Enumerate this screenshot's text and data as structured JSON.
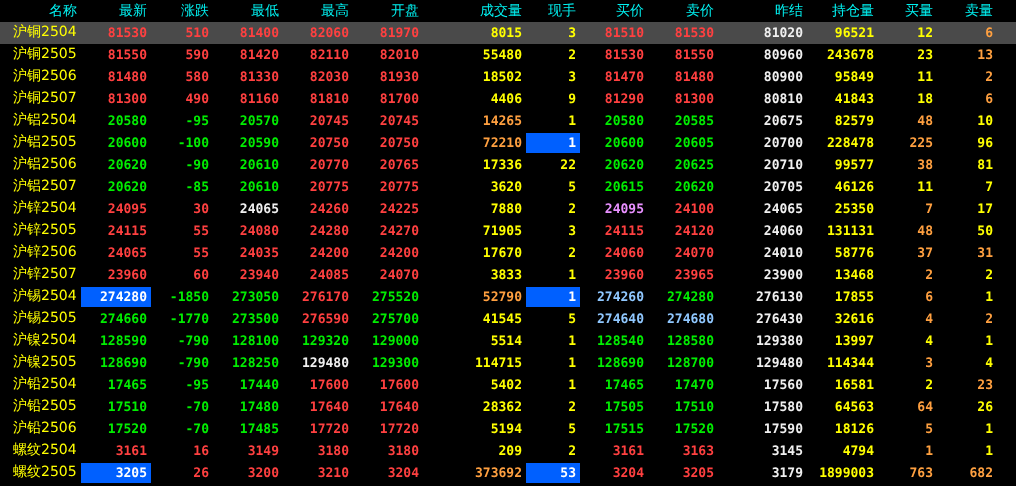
{
  "columns": [
    "名称",
    "最新",
    "涨跌",
    "最低",
    "最高",
    "开盘",
    "成交量",
    "现手",
    "买价",
    "卖价",
    "昨结",
    "持仓量",
    "买量",
    "卖量"
  ],
  "rows": [
    {
      "selected": true,
      "cells": [
        {
          "text": "沪铜2504",
          "color": "#ffff00",
          "highlighted": false
        },
        {
          "text": "81530",
          "color": "#ff4040",
          "highlighted": false
        },
        {
          "text": "510",
          "color": "#ff4040",
          "highlighted": false
        },
        {
          "text": "81400",
          "color": "#ff4040",
          "highlighted": false
        },
        {
          "text": "82060",
          "color": "#ff4040",
          "highlighted": false
        },
        {
          "text": "81970",
          "color": "#ff4040",
          "highlighted": false
        },
        {
          "text": "8015",
          "color": "#ffff00",
          "highlighted": false
        },
        {
          "text": "3",
          "color": "#ffff00",
          "highlighted": false
        },
        {
          "text": "81510",
          "color": "#ff4040",
          "highlighted": false
        },
        {
          "text": "81530",
          "color": "#ff4040",
          "highlighted": false
        },
        {
          "text": "81020",
          "color": "#f0f0f0",
          "highlighted": false
        },
        {
          "text": "96521",
          "color": "#ffff00",
          "highlighted": false
        },
        {
          "text": "12",
          "color": "#ffff00",
          "highlighted": false
        },
        {
          "text": "6",
          "color": "#ffa040",
          "highlighted": false
        }
      ]
    },
    {
      "selected": false,
      "cells": [
        {
          "text": "沪铜2505",
          "color": "#ffff00",
          "highlighted": false
        },
        {
          "text": "81550",
          "color": "#ff4040",
          "highlighted": false
        },
        {
          "text": "590",
          "color": "#ff4040",
          "highlighted": false
        },
        {
          "text": "81420",
          "color": "#ff4040",
          "highlighted": false
        },
        {
          "text": "82110",
          "color": "#ff4040",
          "highlighted": false
        },
        {
          "text": "82010",
          "color": "#ff4040",
          "highlighted": false
        },
        {
          "text": "55480",
          "color": "#ffff00",
          "highlighted": false
        },
        {
          "text": "2",
          "color": "#ffff00",
          "highlighted": false
        },
        {
          "text": "81530",
          "color": "#ff4040",
          "highlighted": false
        },
        {
          "text": "81550",
          "color": "#ff4040",
          "highlighted": false
        },
        {
          "text": "80960",
          "color": "#f0f0f0",
          "highlighted": false
        },
        {
          "text": "243678",
          "color": "#ffff00",
          "highlighted": false
        },
        {
          "text": "23",
          "color": "#ffff00",
          "highlighted": false
        },
        {
          "text": "13",
          "color": "#ffa040",
          "highlighted": false
        }
      ]
    },
    {
      "selected": false,
      "cells": [
        {
          "text": "沪铜2506",
          "color": "#ffff00",
          "highlighted": false
        },
        {
          "text": "81480",
          "color": "#ff4040",
          "highlighted": false
        },
        {
          "text": "580",
          "color": "#ff4040",
          "highlighted": false
        },
        {
          "text": "81330",
          "color": "#ff4040",
          "highlighted": false
        },
        {
          "text": "82030",
          "color": "#ff4040",
          "highlighted": false
        },
        {
          "text": "81930",
          "color": "#ff4040",
          "highlighted": false
        },
        {
          "text": "18502",
          "color": "#ffff00",
          "highlighted": false
        },
        {
          "text": "3",
          "color": "#ffff00",
          "highlighted": false
        },
        {
          "text": "81470",
          "color": "#ff4040",
          "highlighted": false
        },
        {
          "text": "81480",
          "color": "#ff4040",
          "highlighted": false
        },
        {
          "text": "80900",
          "color": "#f0f0f0",
          "highlighted": false
        },
        {
          "text": "95849",
          "color": "#ffff00",
          "highlighted": false
        },
        {
          "text": "11",
          "color": "#ffff00",
          "highlighted": false
        },
        {
          "text": "2",
          "color": "#ffa040",
          "highlighted": false
        }
      ]
    },
    {
      "selected": false,
      "cells": [
        {
          "text": "沪铜2507",
          "color": "#ffff00",
          "highlighted": false
        },
        {
          "text": "81300",
          "color": "#ff4040",
          "highlighted": false
        },
        {
          "text": "490",
          "color": "#ff4040",
          "highlighted": false
        },
        {
          "text": "81160",
          "color": "#ff4040",
          "highlighted": false
        },
        {
          "text": "81810",
          "color": "#ff4040",
          "highlighted": false
        },
        {
          "text": "81700",
          "color": "#ff4040",
          "highlighted": false
        },
        {
          "text": "4406",
          "color": "#ffff00",
          "highlighted": false
        },
        {
          "text": "9",
          "color": "#ffff00",
          "highlighted": false
        },
        {
          "text": "81290",
          "color": "#ff4040",
          "highlighted": false
        },
        {
          "text": "81300",
          "color": "#ff4040",
          "highlighted": false
        },
        {
          "text": "80810",
          "color": "#f0f0f0",
          "highlighted": false
        },
        {
          "text": "41843",
          "color": "#ffff00",
          "highlighted": false
        },
        {
          "text": "18",
          "color": "#ffff00",
          "highlighted": false
        },
        {
          "text": "6",
          "color": "#ffa040",
          "highlighted": false
        }
      ]
    },
    {
      "selected": false,
      "cells": [
        {
          "text": "沪铝2504",
          "color": "#ffff00",
          "highlighted": false
        },
        {
          "text": "20580",
          "color": "#00ee00",
          "highlighted": false
        },
        {
          "text": "-95",
          "color": "#00ee00",
          "highlighted": false
        },
        {
          "text": "20570",
          "color": "#00ee00",
          "highlighted": false
        },
        {
          "text": "20745",
          "color": "#ff4040",
          "highlighted": false
        },
        {
          "text": "20745",
          "color": "#ff4040",
          "highlighted": false
        },
        {
          "text": "14265",
          "color": "#ffa040",
          "highlighted": false
        },
        {
          "text": "1",
          "color": "#ffff00",
          "highlighted": false
        },
        {
          "text": "20580",
          "color": "#00ee00",
          "highlighted": false
        },
        {
          "text": "20585",
          "color": "#00ee00",
          "highlighted": false
        },
        {
          "text": "20675",
          "color": "#f0f0f0",
          "highlighted": false
        },
        {
          "text": "82579",
          "color": "#ffff00",
          "highlighted": false
        },
        {
          "text": "48",
          "color": "#ffa040",
          "highlighted": false
        },
        {
          "text": "10",
          "color": "#ffff00",
          "highlighted": false
        }
      ]
    },
    {
      "selected": false,
      "cells": [
        {
          "text": "沪铝2505",
          "color": "#ffff00",
          "highlighted": false
        },
        {
          "text": "20600",
          "color": "#00ee00",
          "highlighted": false
        },
        {
          "text": "-100",
          "color": "#00ee00",
          "highlighted": false
        },
        {
          "text": "20590",
          "color": "#00ee00",
          "highlighted": false
        },
        {
          "text": "20750",
          "color": "#ff4040",
          "highlighted": false
        },
        {
          "text": "20750",
          "color": "#ff4040",
          "highlighted": false
        },
        {
          "text": "72210",
          "color": "#ffa040",
          "highlighted": false
        },
        {
          "text": "1",
          "color": "#ffffff",
          "highlighted": true
        },
        {
          "text": "20600",
          "color": "#00ee00",
          "highlighted": false
        },
        {
          "text": "20605",
          "color": "#00ee00",
          "highlighted": false
        },
        {
          "text": "20700",
          "color": "#f0f0f0",
          "highlighted": false
        },
        {
          "text": "228478",
          "color": "#ffff00",
          "highlighted": false
        },
        {
          "text": "225",
          "color": "#ffa040",
          "highlighted": false
        },
        {
          "text": "96",
          "color": "#ffff00",
          "highlighted": false
        }
      ]
    },
    {
      "selected": false,
      "cells": [
        {
          "text": "沪铝2506",
          "color": "#ffff00",
          "highlighted": false
        },
        {
          "text": "20620",
          "color": "#00ee00",
          "highlighted": false
        },
        {
          "text": "-90",
          "color": "#00ee00",
          "highlighted": false
        },
        {
          "text": "20610",
          "color": "#00ee00",
          "highlighted": false
        },
        {
          "text": "20770",
          "color": "#ff4040",
          "highlighted": false
        },
        {
          "text": "20765",
          "color": "#ff4040",
          "highlighted": false
        },
        {
          "text": "17336",
          "color": "#ffff00",
          "highlighted": false
        },
        {
          "text": "22",
          "color": "#ffff00",
          "highlighted": false
        },
        {
          "text": "20620",
          "color": "#00ee00",
          "highlighted": false
        },
        {
          "text": "20625",
          "color": "#00ee00",
          "highlighted": false
        },
        {
          "text": "20710",
          "color": "#f0f0f0",
          "highlighted": false
        },
        {
          "text": "99577",
          "color": "#ffff00",
          "highlighted": false
        },
        {
          "text": "38",
          "color": "#ffa040",
          "highlighted": false
        },
        {
          "text": "81",
          "color": "#ffff00",
          "highlighted": false
        }
      ]
    },
    {
      "selected": false,
      "cells": [
        {
          "text": "沪铝2507",
          "color": "#ffff00",
          "highlighted": false
        },
        {
          "text": "20620",
          "color": "#00ee00",
          "highlighted": false
        },
        {
          "text": "-85",
          "color": "#00ee00",
          "highlighted": false
        },
        {
          "text": "20610",
          "color": "#00ee00",
          "highlighted": false
        },
        {
          "text": "20775",
          "color": "#ff4040",
          "highlighted": false
        },
        {
          "text": "20775",
          "color": "#ff4040",
          "highlighted": false
        },
        {
          "text": "3620",
          "color": "#ffff00",
          "highlighted": false
        },
        {
          "text": "5",
          "color": "#ffff00",
          "highlighted": false
        },
        {
          "text": "20615",
          "color": "#00ee00",
          "highlighted": false
        },
        {
          "text": "20620",
          "color": "#00ee00",
          "highlighted": false
        },
        {
          "text": "20705",
          "color": "#f0f0f0",
          "highlighted": false
        },
        {
          "text": "46126",
          "color": "#ffff00",
          "highlighted": false
        },
        {
          "text": "11",
          "color": "#ffff00",
          "highlighted": false
        },
        {
          "text": "7",
          "color": "#ffff00",
          "highlighted": false
        }
      ]
    },
    {
      "selected": false,
      "cells": [
        {
          "text": "沪锌2504",
          "color": "#ffff00",
          "highlighted": false
        },
        {
          "text": "24095",
          "color": "#ff4040",
          "highlighted": false
        },
        {
          "text": "30",
          "color": "#ff4040",
          "highlighted": false
        },
        {
          "text": "24065",
          "color": "#f0f0f0",
          "highlighted": false
        },
        {
          "text": "24260",
          "color": "#ff4040",
          "highlighted": false
        },
        {
          "text": "24225",
          "color": "#ff4040",
          "highlighted": false
        },
        {
          "text": "7880",
          "color": "#ffff00",
          "highlighted": false
        },
        {
          "text": "2",
          "color": "#ffff00",
          "highlighted": false
        },
        {
          "text": "24095",
          "color": "#e890ff",
          "highlighted": false
        },
        {
          "text": "24100",
          "color": "#ff4040",
          "highlighted": false
        },
        {
          "text": "24065",
          "color": "#f0f0f0",
          "highlighted": false
        },
        {
          "text": "25350",
          "color": "#ffff00",
          "highlighted": false
        },
        {
          "text": "7",
          "color": "#ffa040",
          "highlighted": false
        },
        {
          "text": "17",
          "color": "#ffff00",
          "highlighted": false
        }
      ]
    },
    {
      "selected": false,
      "cells": [
        {
          "text": "沪锌2505",
          "color": "#ffff00",
          "highlighted": false
        },
        {
          "text": "24115",
          "color": "#ff4040",
          "highlighted": false
        },
        {
          "text": "55",
          "color": "#ff4040",
          "highlighted": false
        },
        {
          "text": "24080",
          "color": "#ff4040",
          "highlighted": false
        },
        {
          "text": "24280",
          "color": "#ff4040",
          "highlighted": false
        },
        {
          "text": "24270",
          "color": "#ff4040",
          "highlighted": false
        },
        {
          "text": "71905",
          "color": "#ffff00",
          "highlighted": false
        },
        {
          "text": "3",
          "color": "#ffff00",
          "highlighted": false
        },
        {
          "text": "24115",
          "color": "#ff4040",
          "highlighted": false
        },
        {
          "text": "24120",
          "color": "#ff4040",
          "highlighted": false
        },
        {
          "text": "24060",
          "color": "#f0f0f0",
          "highlighted": false
        },
        {
          "text": "131131",
          "color": "#ffff00",
          "highlighted": false
        },
        {
          "text": "48",
          "color": "#ffa040",
          "highlighted": false
        },
        {
          "text": "50",
          "color": "#ffff00",
          "highlighted": false
        }
      ]
    },
    {
      "selected": false,
      "cells": [
        {
          "text": "沪锌2506",
          "color": "#ffff00",
          "highlighted": false
        },
        {
          "text": "24065",
          "color": "#ff4040",
          "highlighted": false
        },
        {
          "text": "55",
          "color": "#ff4040",
          "highlighted": false
        },
        {
          "text": "24035",
          "color": "#ff4040",
          "highlighted": false
        },
        {
          "text": "24200",
          "color": "#ff4040",
          "highlighted": false
        },
        {
          "text": "24200",
          "color": "#ff4040",
          "highlighted": false
        },
        {
          "text": "17670",
          "color": "#ffff00",
          "highlighted": false
        },
        {
          "text": "2",
          "color": "#ffff00",
          "highlighted": false
        },
        {
          "text": "24060",
          "color": "#ff4040",
          "highlighted": false
        },
        {
          "text": "24070",
          "color": "#ff4040",
          "highlighted": false
        },
        {
          "text": "24010",
          "color": "#f0f0f0",
          "highlighted": false
        },
        {
          "text": "58776",
          "color": "#ffff00",
          "highlighted": false
        },
        {
          "text": "37",
          "color": "#ffa040",
          "highlighted": false
        },
        {
          "text": "31",
          "color": "#ffa040",
          "highlighted": false
        }
      ]
    },
    {
      "selected": false,
      "cells": [
        {
          "text": "沪锌2507",
          "color": "#ffff00",
          "highlighted": false
        },
        {
          "text": "23960",
          "color": "#ff4040",
          "highlighted": false
        },
        {
          "text": "60",
          "color": "#ff4040",
          "highlighted": false
        },
        {
          "text": "23940",
          "color": "#ff4040",
          "highlighted": false
        },
        {
          "text": "24085",
          "color": "#ff4040",
          "highlighted": false
        },
        {
          "text": "24070",
          "color": "#ff4040",
          "highlighted": false
        },
        {
          "text": "3833",
          "color": "#ffff00",
          "highlighted": false
        },
        {
          "text": "1",
          "color": "#ffff00",
          "highlighted": false
        },
        {
          "text": "23960",
          "color": "#ff4040",
          "highlighted": false
        },
        {
          "text": "23965",
          "color": "#ff4040",
          "highlighted": false
        },
        {
          "text": "23900",
          "color": "#f0f0f0",
          "highlighted": false
        },
        {
          "text": "13468",
          "color": "#ffff00",
          "highlighted": false
        },
        {
          "text": "2",
          "color": "#ffa040",
          "highlighted": false
        },
        {
          "text": "2",
          "color": "#ffff00",
          "highlighted": false
        }
      ]
    },
    {
      "selected": false,
      "cells": [
        {
          "text": "沪锡2504",
          "color": "#ffff00",
          "highlighted": false
        },
        {
          "text": "274280",
          "color": "#ffffff",
          "highlighted": true
        },
        {
          "text": "-1850",
          "color": "#00ee00",
          "highlighted": false
        },
        {
          "text": "273050",
          "color": "#00ee00",
          "highlighted": false
        },
        {
          "text": "276170",
          "color": "#ff4040",
          "highlighted": false
        },
        {
          "text": "275520",
          "color": "#00ee00",
          "highlighted": false
        },
        {
          "text": "52790",
          "color": "#ffa040",
          "highlighted": false
        },
        {
          "text": "1",
          "color": "#ffffff",
          "highlighted": true
        },
        {
          "text": "274260",
          "color": "#90c8ff",
          "highlighted": false
        },
        {
          "text": "274280",
          "color": "#00ee00",
          "highlighted": false
        },
        {
          "text": "276130",
          "color": "#f0f0f0",
          "highlighted": false
        },
        {
          "text": "17855",
          "color": "#ffff00",
          "highlighted": false
        },
        {
          "text": "6",
          "color": "#ffa040",
          "highlighted": false
        },
        {
          "text": "1",
          "color": "#ffff00",
          "highlighted": false
        }
      ]
    },
    {
      "selected": false,
      "cells": [
        {
          "text": "沪锡2505",
          "color": "#ffff00",
          "highlighted": false
        },
        {
          "text": "274660",
          "color": "#00ee00",
          "highlighted": false
        },
        {
          "text": "-1770",
          "color": "#00ee00",
          "highlighted": false
        },
        {
          "text": "273500",
          "color": "#00ee00",
          "highlighted": false
        },
        {
          "text": "276590",
          "color": "#ff4040",
          "highlighted": false
        },
        {
          "text": "275700",
          "color": "#00ee00",
          "highlighted": false
        },
        {
          "text": "41545",
          "color": "#ffff00",
          "highlighted": false
        },
        {
          "text": "5",
          "color": "#ffff00",
          "highlighted": false
        },
        {
          "text": "274640",
          "color": "#90c8ff",
          "highlighted": false
        },
        {
          "text": "274680",
          "color": "#90c8ff",
          "highlighted": false
        },
        {
          "text": "276430",
          "color": "#f0f0f0",
          "highlighted": false
        },
        {
          "text": "32616",
          "color": "#ffff00",
          "highlighted": false
        },
        {
          "text": "4",
          "color": "#ffa040",
          "highlighted": false
        },
        {
          "text": "2",
          "color": "#ffa040",
          "highlighted": false
        }
      ]
    },
    {
      "selected": false,
      "cells": [
        {
          "text": "沪镍2504",
          "color": "#ffff00",
          "highlighted": false
        },
        {
          "text": "128590",
          "color": "#00ee00",
          "highlighted": false
        },
        {
          "text": "-790",
          "color": "#00ee00",
          "highlighted": false
        },
        {
          "text": "128100",
          "color": "#00ee00",
          "highlighted": false
        },
        {
          "text": "129320",
          "color": "#00ee00",
          "highlighted": false
        },
        {
          "text": "129000",
          "color": "#00ee00",
          "highlighted": false
        },
        {
          "text": "5514",
          "color": "#ffff00",
          "highlighted": false
        },
        {
          "text": "1",
          "color": "#ffff00",
          "highlighted": false
        },
        {
          "text": "128540",
          "color": "#00ee00",
          "highlighted": false
        },
        {
          "text": "128580",
          "color": "#00ee00",
          "highlighted": false
        },
        {
          "text": "129380",
          "color": "#f0f0f0",
          "highlighted": false
        },
        {
          "text": "13997",
          "color": "#ffff00",
          "highlighted": false
        },
        {
          "text": "4",
          "color": "#ffff00",
          "highlighted": false
        },
        {
          "text": "1",
          "color": "#ffff00",
          "highlighted": false
        }
      ]
    },
    {
      "selected": false,
      "cells": [
        {
          "text": "沪镍2505",
          "color": "#ffff00",
          "highlighted": false
        },
        {
          "text": "128690",
          "color": "#00ee00",
          "highlighted": false
        },
        {
          "text": "-790",
          "color": "#00ee00",
          "highlighted": false
        },
        {
          "text": "128250",
          "color": "#00ee00",
          "highlighted": false
        },
        {
          "text": "129480",
          "color": "#f0f0f0",
          "highlighted": false
        },
        {
          "text": "129300",
          "color": "#00ee00",
          "highlighted": false
        },
        {
          "text": "114715",
          "color": "#ffff00",
          "highlighted": false
        },
        {
          "text": "1",
          "color": "#ffff00",
          "highlighted": false
        },
        {
          "text": "128690",
          "color": "#00ee00",
          "highlighted": false
        },
        {
          "text": "128700",
          "color": "#00ee00",
          "highlighted": false
        },
        {
          "text": "129480",
          "color": "#f0f0f0",
          "highlighted": false
        },
        {
          "text": "114344",
          "color": "#ffff00",
          "highlighted": false
        },
        {
          "text": "3",
          "color": "#ffa040",
          "highlighted": false
        },
        {
          "text": "4",
          "color": "#ffff00",
          "highlighted": false
        }
      ]
    },
    {
      "selected": false,
      "cells": [
        {
          "text": "沪铅2504",
          "color": "#ffff00",
          "highlighted": false
        },
        {
          "text": "17465",
          "color": "#00ee00",
          "highlighted": false
        },
        {
          "text": "-95",
          "color": "#00ee00",
          "highlighted": false
        },
        {
          "text": "17440",
          "color": "#00ee00",
          "highlighted": false
        },
        {
          "text": "17600",
          "color": "#ff4040",
          "highlighted": false
        },
        {
          "text": "17600",
          "color": "#ff4040",
          "highlighted": false
        },
        {
          "text": "5402",
          "color": "#ffff00",
          "highlighted": false
        },
        {
          "text": "1",
          "color": "#ffff00",
          "highlighted": false
        },
        {
          "text": "17465",
          "color": "#00ee00",
          "highlighted": false
        },
        {
          "text": "17470",
          "color": "#00ee00",
          "highlighted": false
        },
        {
          "text": "17560",
          "color": "#f0f0f0",
          "highlighted": false
        },
        {
          "text": "16581",
          "color": "#ffff00",
          "highlighted": false
        },
        {
          "text": "2",
          "color": "#ffff00",
          "highlighted": false
        },
        {
          "text": "23",
          "color": "#ffa040",
          "highlighted": false
        }
      ]
    },
    {
      "selected": false,
      "cells": [
        {
          "text": "沪铅2505",
          "color": "#ffff00",
          "highlighted": false
        },
        {
          "text": "17510",
          "color": "#00ee00",
          "highlighted": false
        },
        {
          "text": "-70",
          "color": "#00ee00",
          "highlighted": false
        },
        {
          "text": "17480",
          "color": "#00ee00",
          "highlighted": false
        },
        {
          "text": "17640",
          "color": "#ff4040",
          "highlighted": false
        },
        {
          "text": "17640",
          "color": "#ff4040",
          "highlighted": false
        },
        {
          "text": "28362",
          "color": "#ffff00",
          "highlighted": false
        },
        {
          "text": "2",
          "color": "#ffff00",
          "highlighted": false
        },
        {
          "text": "17505",
          "color": "#00ee00",
          "highlighted": false
        },
        {
          "text": "17510",
          "color": "#00ee00",
          "highlighted": false
        },
        {
          "text": "17580",
          "color": "#f0f0f0",
          "highlighted": false
        },
        {
          "text": "64563",
          "color": "#ffff00",
          "highlighted": false
        },
        {
          "text": "64",
          "color": "#ffa040",
          "highlighted": false
        },
        {
          "text": "26",
          "color": "#ffff00",
          "highlighted": false
        }
      ]
    },
    {
      "selected": false,
      "cells": [
        {
          "text": "沪铅2506",
          "color": "#ffff00",
          "highlighted": false
        },
        {
          "text": "17520",
          "color": "#00ee00",
          "highlighted": false
        },
        {
          "text": "-70",
          "color": "#00ee00",
          "highlighted": false
        },
        {
          "text": "17485",
          "color": "#00ee00",
          "highlighted": false
        },
        {
          "text": "17720",
          "color": "#ff4040",
          "highlighted": false
        },
        {
          "text": "17720",
          "color": "#ff4040",
          "highlighted": false
        },
        {
          "text": "5194",
          "color": "#ffff00",
          "highlighted": false
        },
        {
          "text": "5",
          "color": "#ffff00",
          "highlighted": false
        },
        {
          "text": "17515",
          "color": "#00ee00",
          "highlighted": false
        },
        {
          "text": "17520",
          "color": "#00ee00",
          "highlighted": false
        },
        {
          "text": "17590",
          "color": "#f0f0f0",
          "highlighted": false
        },
        {
          "text": "18126",
          "color": "#ffff00",
          "highlighted": false
        },
        {
          "text": "5",
          "color": "#ffa040",
          "highlighted": false
        },
        {
          "text": "1",
          "color": "#ffff00",
          "highlighted": false
        }
      ]
    },
    {
      "selected": false,
      "cells": [
        {
          "text": "螺纹2504",
          "color": "#ffff00",
          "highlighted": false
        },
        {
          "text": "3161",
          "color": "#ff4040",
          "highlighted": false
        },
        {
          "text": "16",
          "color": "#ff4040",
          "highlighted": false
        },
        {
          "text": "3149",
          "color": "#ff4040",
          "highlighted": false
        },
        {
          "text": "3180",
          "color": "#ff4040",
          "highlighted": false
        },
        {
          "text": "3180",
          "color": "#ff4040",
          "highlighted": false
        },
        {
          "text": "209",
          "color": "#ffff00",
          "highlighted": false
        },
        {
          "text": "2",
          "color": "#ffff00",
          "highlighted": false
        },
        {
          "text": "3161",
          "color": "#ff4040",
          "highlighted": false
        },
        {
          "text": "3163",
          "color": "#ff4040",
          "highlighted": false
        },
        {
          "text": "3145",
          "color": "#f0f0f0",
          "highlighted": false
        },
        {
          "text": "4794",
          "color": "#ffff00",
          "highlighted": false
        },
        {
          "text": "1",
          "color": "#ffa040",
          "highlighted": false
        },
        {
          "text": "1",
          "color": "#ffff00",
          "highlighted": false
        }
      ]
    },
    {
      "selected": false,
      "cells": [
        {
          "text": "螺纹2505",
          "color": "#ffff00",
          "highlighted": false
        },
        {
          "text": "3205",
          "color": "#ffffff",
          "highlighted": true
        },
        {
          "text": "26",
          "color": "#ff4040",
          "highlighted": false
        },
        {
          "text": "3200",
          "color": "#ff4040",
          "highlighted": false
        },
        {
          "text": "3210",
          "color": "#ff4040",
          "highlighted": false
        },
        {
          "text": "3204",
          "color": "#ff4040",
          "highlighted": false
        },
        {
          "text": "373692",
          "color": "#ffa040",
          "highlighted": false
        },
        {
          "text": "53",
          "color": "#ffffff",
          "highlighted": true
        },
        {
          "text": "3204",
          "color": "#ff4040",
          "highlighted": false
        },
        {
          "text": "3205",
          "color": "#ff4040",
          "highlighted": false
        },
        {
          "text": "3179",
          "color": "#f0f0f0",
          "highlighted": false
        },
        {
          "text": "1899003",
          "color": "#ffff00",
          "highlighted": false
        },
        {
          "text": "763",
          "color": "#ffa040",
          "highlighted": false
        },
        {
          "text": "682",
          "color": "#ffa040",
          "highlighted": false
        }
      ]
    }
  ]
}
